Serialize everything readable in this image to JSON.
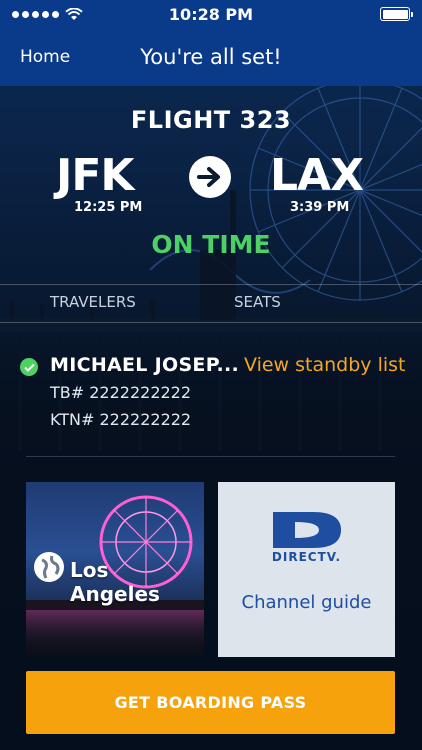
{
  "status_bar": {
    "time": "10:28 PM"
  },
  "nav": {
    "home_label": "Home",
    "title": "You're all set!"
  },
  "flight": {
    "title": "FLIGHT 323",
    "origin": {
      "code": "JFK",
      "time": "12:25 PM"
    },
    "destination": {
      "code": "LAX",
      "time": "3:39 PM"
    },
    "status": "ON TIME"
  },
  "tabs": {
    "travelers": "TRAVELERS",
    "seats": "SEATS"
  },
  "traveler": {
    "name": "MICHAEL JOSEP...",
    "tb": "TB#  2222222222",
    "ktn": "KTN# 222222222",
    "standby_link": "View standby list"
  },
  "cards": {
    "destination_city": "Los Angeles",
    "directv_brand": "DIRECTV.",
    "directv_label": "Channel guide"
  },
  "cta": {
    "boarding_pass": "GET BOARDING PASS"
  },
  "colors": {
    "nav_blue": "#0a3a8a",
    "on_time_green": "#4ed164",
    "accent_orange": "#f5a623",
    "cta_orange": "#f5a20c"
  }
}
